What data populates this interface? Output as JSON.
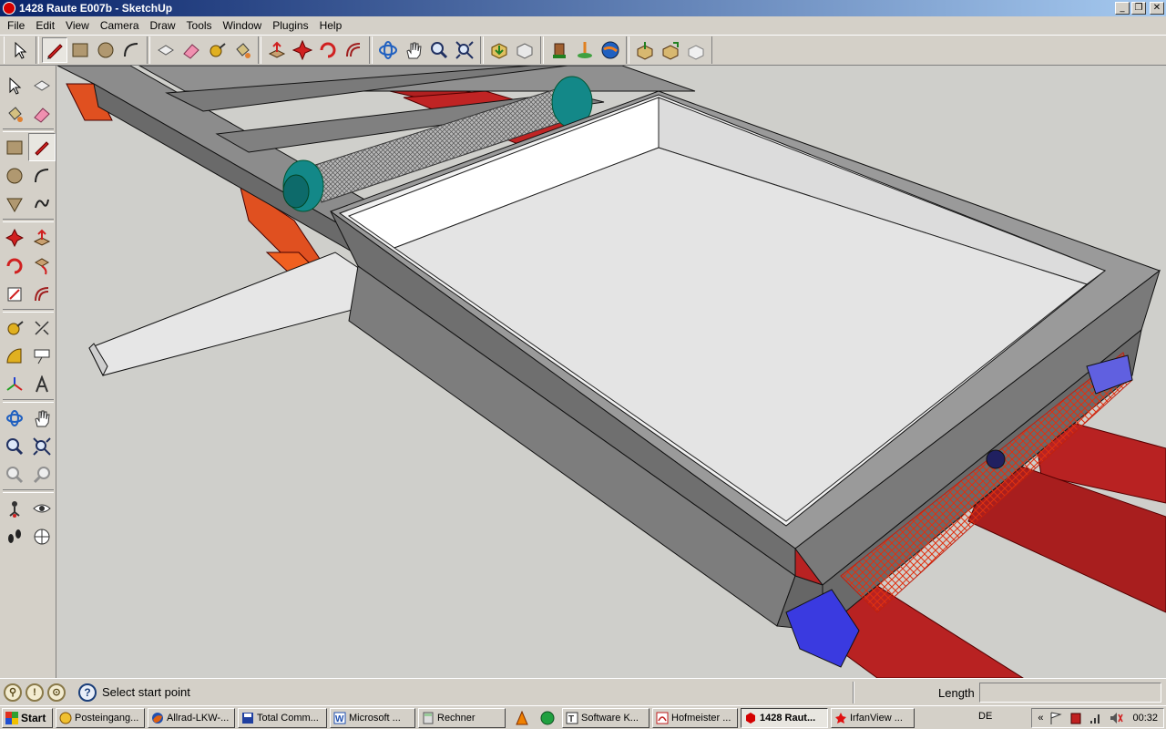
{
  "window": {
    "title": "1428 Raute E007b - SketchUp"
  },
  "menu": [
    {
      "label": "File",
      "key": "F"
    },
    {
      "label": "Edit",
      "key": "E"
    },
    {
      "label": "View",
      "key": "V"
    },
    {
      "label": "Camera",
      "key": "C"
    },
    {
      "label": "Draw",
      "key": "D"
    },
    {
      "label": "Tools",
      "key": "T"
    },
    {
      "label": "Window",
      "key": "W"
    },
    {
      "label": "Plugins",
      "key": "P"
    },
    {
      "label": "Help",
      "key": "H"
    }
  ],
  "status": {
    "hint": "Select start point",
    "vcb_label": "Length",
    "vcb_value": ""
  },
  "taskbar": {
    "start_label": "Start",
    "tasks": [
      {
        "label": "Posteingang...",
        "icon": "clock-icon",
        "color": "#e0a000"
      },
      {
        "label": "Allrad-LKW-...",
        "icon": "firefox-icon",
        "color": "#d05010"
      },
      {
        "label": "Total Comm...",
        "icon": "floppy-icon",
        "color": "#2040a0"
      },
      {
        "label": "Microsoft ...",
        "icon": "word-icon",
        "color": "#2050b0"
      },
      {
        "label": "Rechner",
        "icon": "calculator-icon",
        "color": "#606060"
      },
      {
        "label": "Software K...",
        "icon": "text-icon",
        "color": "#303030"
      },
      {
        "label": "Hofmeister ...",
        "icon": "pdf-icon",
        "color": "#c02020"
      },
      {
        "label": "1428 Raut...",
        "icon": "sketchup-icon",
        "color": "#d40000",
        "active": true
      },
      {
        "label": "IrfanView ...",
        "icon": "irfanview-icon",
        "color": "#c01010"
      }
    ],
    "language": "DE",
    "clock": "00:32"
  }
}
